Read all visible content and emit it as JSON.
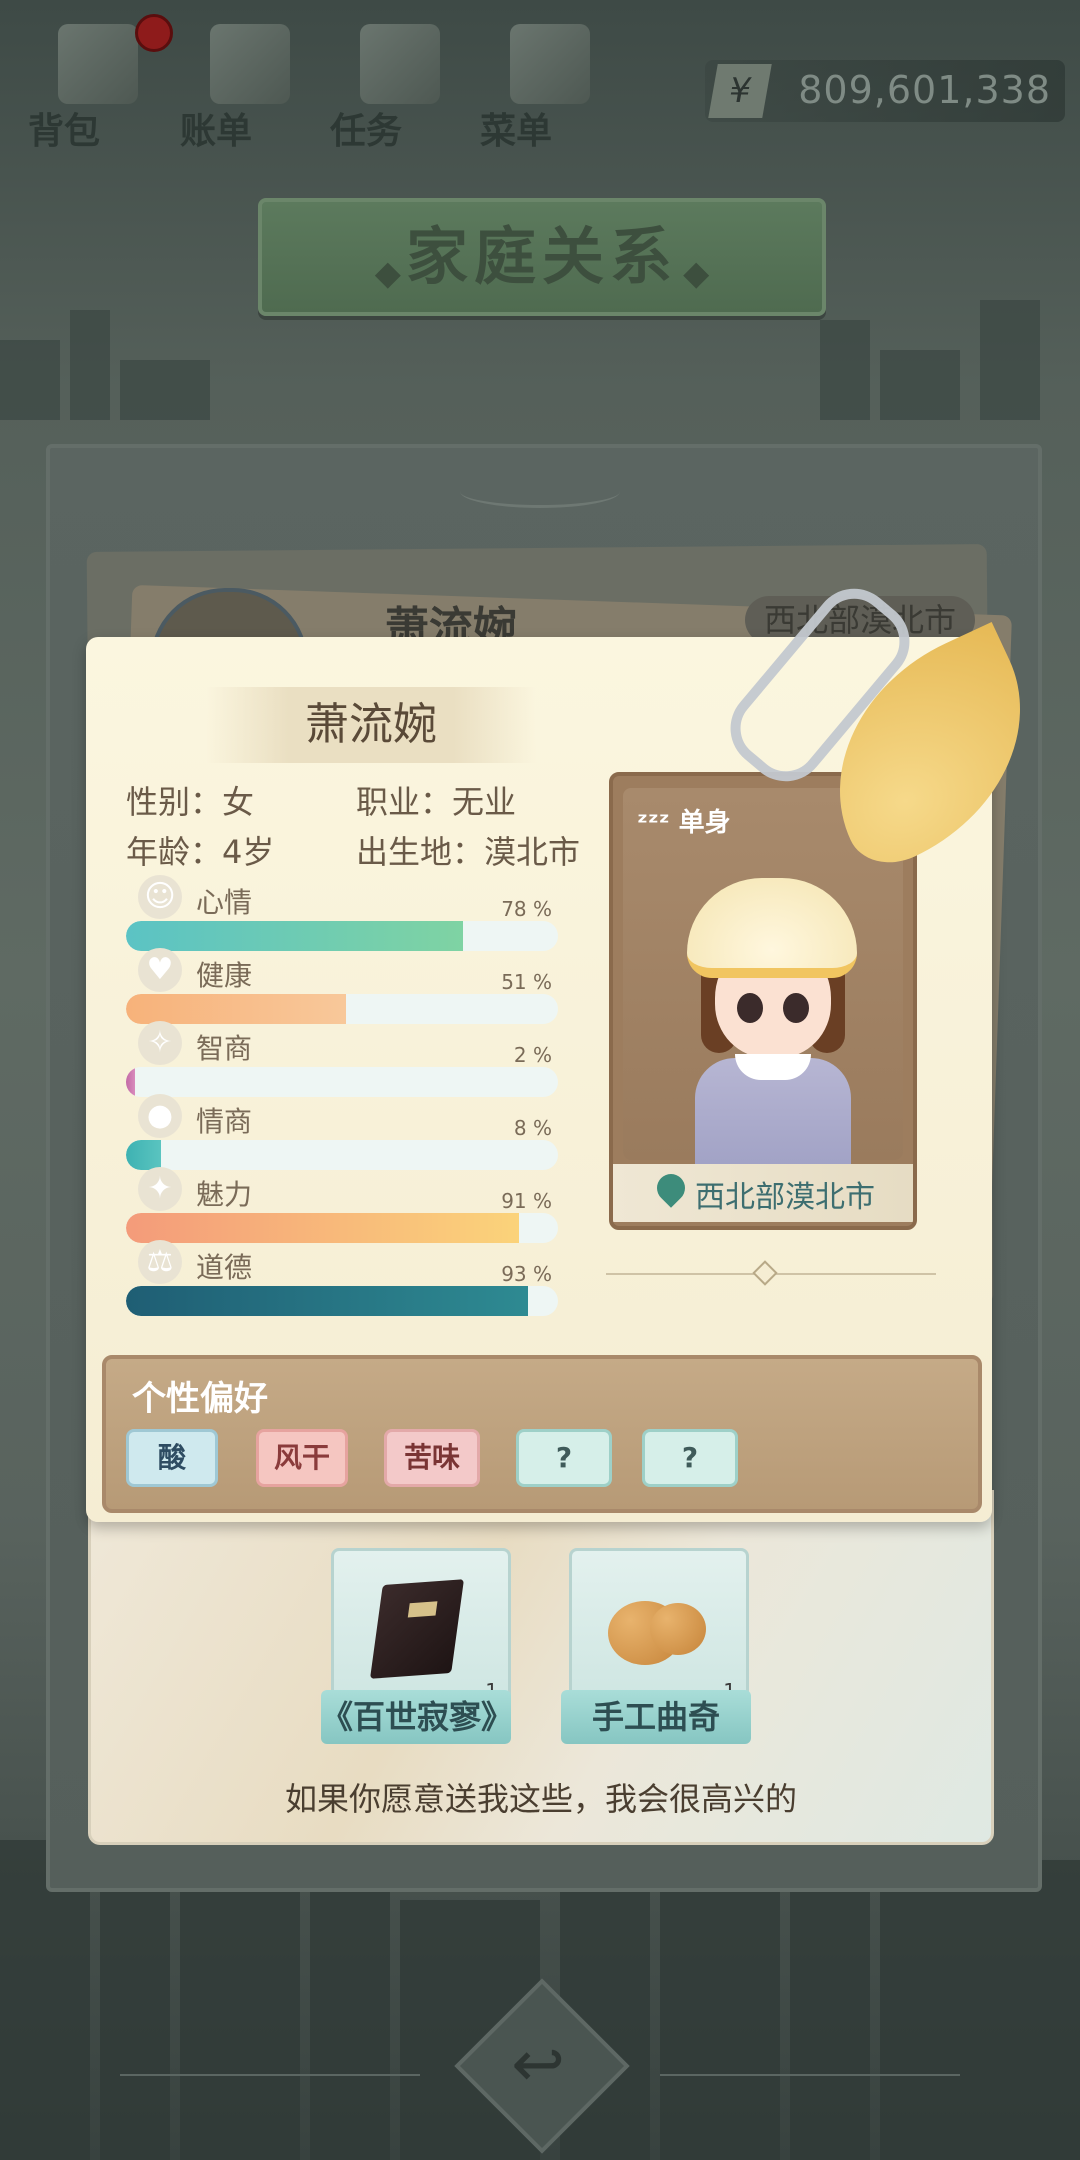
{
  "top_bar": {
    "items": [
      {
        "label": "背包",
        "icon": "backpack-icon"
      },
      {
        "label": "账单",
        "icon": "bill-icon"
      },
      {
        "label": "任务",
        "icon": "task-icon"
      },
      {
        "label": "菜单",
        "icon": "menu-icon"
      }
    ],
    "currency_symbol": "¥",
    "money": "809,601,338"
  },
  "title": "家庭关系",
  "title_ornament": "◆",
  "background_card": {
    "name": "萧流婉",
    "location": "西北部漠北市"
  },
  "profile": {
    "name": "萧流婉",
    "gender": "性别：女",
    "occupation": "职业：无业",
    "age": "年龄：4岁",
    "birthplace": "出生地：漠北市",
    "status": "单身",
    "location": "西北部漠北市",
    "stats": [
      {
        "label": "心情",
        "value": 78,
        "pct": "78 %",
        "icon": "smiley-icon",
        "color_from": "#5bc3c4",
        "color_to": "#7fd3a3"
      },
      {
        "label": "健康",
        "value": 51,
        "pct": "51 %",
        "icon": "heart-icon",
        "color_from": "#f7b27a",
        "color_to": "#f8c89a"
      },
      {
        "label": "智商",
        "value": 2,
        "pct": "2 %",
        "icon": "lightbulb-icon",
        "color_from": "#c36aa5",
        "color_to": "#d98bbd"
      },
      {
        "label": "情商",
        "value": 8,
        "pct": "8 %",
        "icon": "apple-icon",
        "color_from": "#3eb2b2",
        "color_to": "#5ac4c0"
      },
      {
        "label": "魅力",
        "value": 91,
        "pct": "91 %",
        "icon": "sparkle-icon",
        "color_from": "#f49b7a",
        "color_to": "#fbd37a"
      },
      {
        "label": "道德",
        "value": 93,
        "pct": "93 %",
        "icon": "scales-icon",
        "color_from": "#1f5e74",
        "color_to": "#2e8a92"
      }
    ]
  },
  "preferences": {
    "title": "个性偏好",
    "chips": [
      "酸",
      "风干",
      "苦味",
      "?",
      "?"
    ]
  },
  "gifts": {
    "items": [
      {
        "label": "《百世寂寥》",
        "count": "1",
        "icon": "book-icon"
      },
      {
        "label": "手工曲奇",
        "count": "1",
        "icon": "cookie-icon"
      }
    ],
    "description": "如果你愿意送我这些，我会很高兴的"
  },
  "colors": {
    "card_bg": "#f8f1da",
    "pref_panel": "#bfa27f",
    "gift_label": "#97cfcb"
  }
}
